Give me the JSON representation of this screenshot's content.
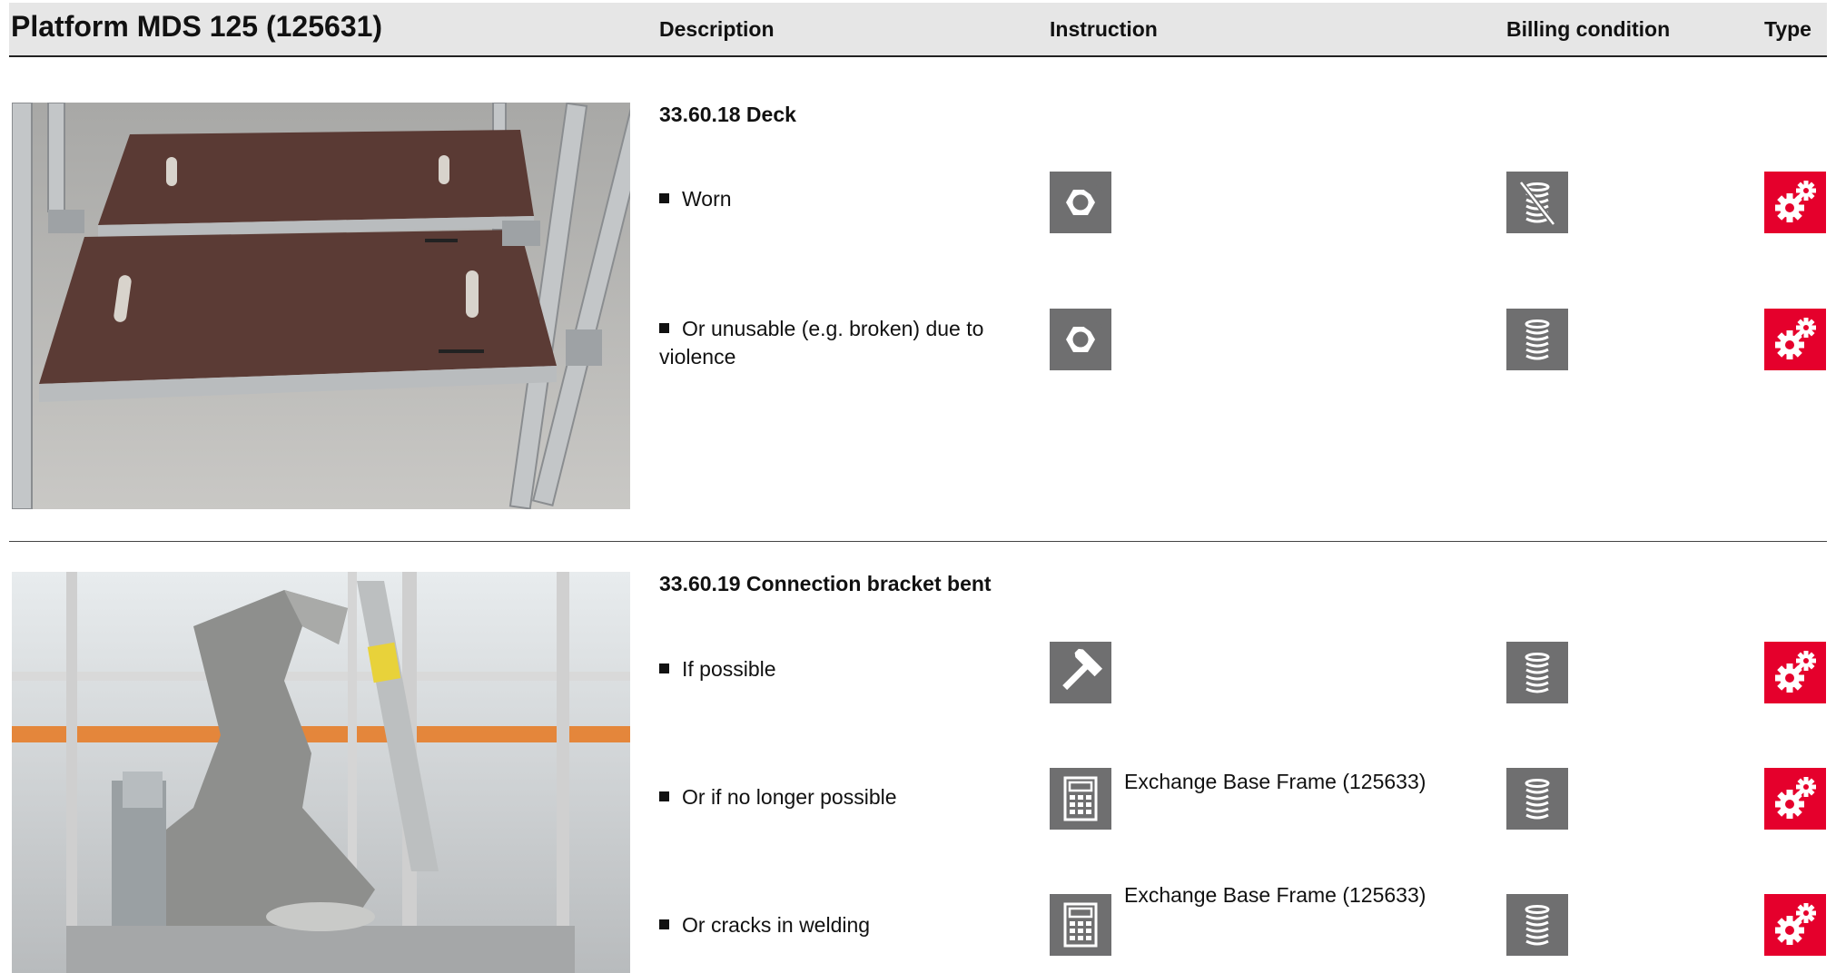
{
  "header": {
    "title": "Platform MDS 125 (125631)",
    "col_description": "Description",
    "col_instruction": "Instruction",
    "col_billing": "Billing condition",
    "col_type": "Type"
  },
  "sections": [
    {
      "title": "33.60.18 Deck",
      "rows": [
        {
          "text": "Worn",
          "instruction_icon": "hex-nut-icon",
          "billing_icon": "coins-crossed-icon",
          "type_icon": "gears-icon"
        },
        {
          "text": "Or unusable (e.g. broken) due to violence",
          "instruction_icon": "hex-nut-icon",
          "billing_icon": "coins-icon",
          "type_icon": "gears-icon"
        }
      ]
    },
    {
      "title": "33.60.19 Connection bracket bent",
      "rows": [
        {
          "text": "If possible",
          "instruction_icon": "hammer-icon",
          "billing_icon": "coins-icon",
          "type_icon": "gears-icon"
        },
        {
          "text": "Or if no longer possible",
          "instruction_icon": "calculator-icon",
          "note": "Exchange Base Frame (125633)",
          "billing_icon": "coins-icon",
          "type_icon": "gears-icon"
        },
        {
          "text": "Or cracks in welding",
          "instruction_icon": "calculator-icon",
          "note": "Exchange Base Frame (125633)",
          "billing_icon": "coins-icon",
          "type_icon": "gears-icon"
        }
      ]
    }
  ],
  "colors": {
    "icon_gray": "#6f6f70",
    "type_red": "#e5002c",
    "header_bg": "#e6e6e6"
  }
}
